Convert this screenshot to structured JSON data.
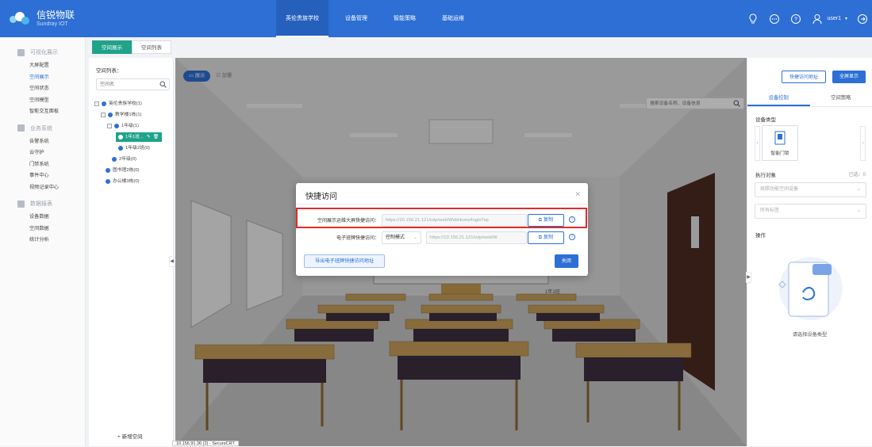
{
  "app": {
    "brand_cn": "信锐物联",
    "brand_en": "Sundray IOT"
  },
  "topnav": {
    "items": [
      {
        "label": "英伦贵族学校",
        "active": true
      },
      {
        "label": "设备管理",
        "active": false
      },
      {
        "label": "智能策略",
        "active": false
      },
      {
        "label": "基础运维",
        "active": false
      }
    ],
    "user": "user1",
    "icons": [
      "lightbulb-icon",
      "message-icon",
      "help-icon",
      "user-icon",
      "logout-icon"
    ]
  },
  "sidebar": {
    "groups": [
      {
        "label": "可视化展示",
        "items": [
          "大屏配置",
          "空间展示",
          "空间状态",
          "空间模型",
          "智能交互面板"
        ]
      },
      {
        "label": "业务系统",
        "items": [
          "告警系统",
          "云守护",
          "门禁系统",
          "事件中心",
          "视频记录中心"
        ]
      },
      {
        "label": "数据报表",
        "items": [
          "设备数据",
          "空间数据",
          "统计分析"
        ]
      }
    ],
    "active_item": "空间展示"
  },
  "tabs": [
    {
      "label": "空间展示",
      "active": true
    },
    {
      "label": "空间列表",
      "active": false
    }
  ],
  "tree": {
    "title": "空间列表：",
    "search_placeholder": "空间名",
    "nodes": [
      {
        "label": "英伦贵族学校(1)"
      },
      {
        "label": "教学楼1栋(1)"
      },
      {
        "label": "1年级(1)"
      },
      {
        "label": "1年1班..."
      },
      {
        "label": "1年级2班(0)"
      },
      {
        "label": "2年级(0)"
      },
      {
        "label": "图书馆2栋(0)"
      },
      {
        "label": "办公楼3栋(0)"
      }
    ],
    "add_label": "+ 新增空间"
  },
  "scene": {
    "toggle_on": "展示",
    "toggle_off": "部署",
    "search_placeholder": "搜索设备名称、设备信息",
    "btn_quick": "快捷访问地址",
    "btn_fullscreen": "全屏显示",
    "class_label": "1年1班"
  },
  "rightpanel": {
    "tabs": [
      {
        "label": "设备控制",
        "active": true
      },
      {
        "label": "空间策略",
        "active": false
      }
    ],
    "device_type_label": "设备类型",
    "device_card": "智能门锁",
    "exec_label": "执行对象",
    "selected_count": "已选：0",
    "select1": "按照功能空间设备",
    "select2": "所有标签",
    "ops_label": "操作",
    "empty_text": "请选择设备类型"
  },
  "dialog": {
    "title": "快捷访问",
    "row1_label": "空间展示运维大屏快捷访问：",
    "row1_url": "https://10.156.21.121/iotp/web/WebHome/login?sp",
    "row2_label": "电子班牌快捷访问：",
    "row2_mode": "控制模式",
    "row2_url": "https://10.156.21.121/iotp/web/W",
    "copy_label": "复制",
    "export_label": "导出电子班牌快捷访问地址",
    "close_label": "关闭"
  },
  "tooltip": "10.156.91.36 (2) - SecureCRT",
  "colors": {
    "primary": "#2d6fd4",
    "teal": "#1fa38a",
    "highlight": "#e02b2b"
  }
}
